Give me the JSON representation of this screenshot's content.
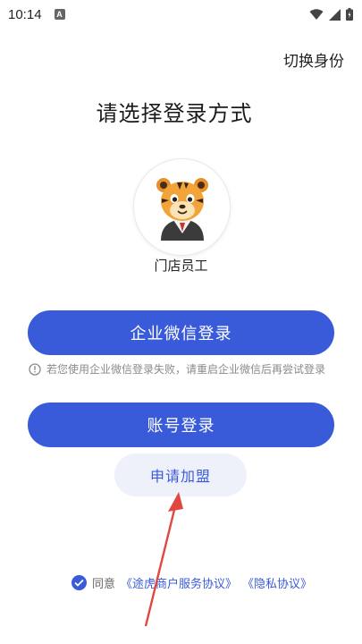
{
  "status_bar": {
    "time": "10:14",
    "notification_letter": "A"
  },
  "header": {
    "switch_identity": "切换身份",
    "title": "请选择登录方式"
  },
  "role": {
    "label": "门店员工"
  },
  "buttons": {
    "wechat_login": "企业微信登录",
    "account_login": "账号登录",
    "apply_join": "申请加盟"
  },
  "hint": {
    "text": "若您使用企业微信登录失败，请重启企业微信后再尝试登录"
  },
  "agreement": {
    "prefix": "同意",
    "service_link": "《途虎商户服务协议》",
    "privacy_link": "《隐私协议》",
    "checked": true
  },
  "colors": {
    "primary": "#3a5bd9",
    "secondary_bg": "#eef1fa",
    "annotation_arrow": "#e0473f"
  }
}
